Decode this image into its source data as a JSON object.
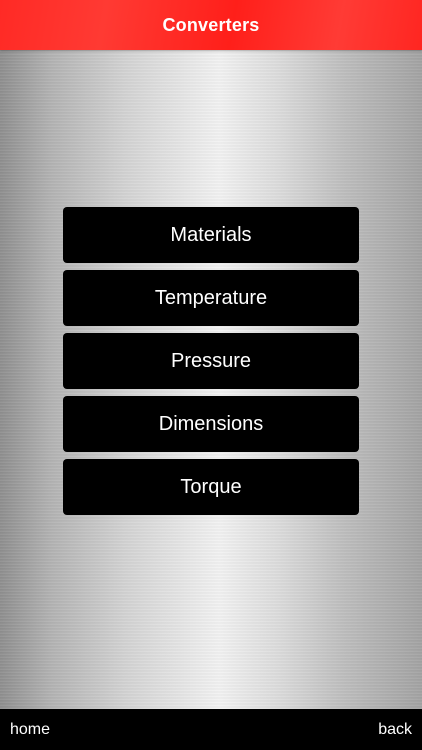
{
  "header": {
    "title": "Converters",
    "background_color": "#ff2a25"
  },
  "menu": {
    "items": [
      {
        "label": "Materials"
      },
      {
        "label": "Temperature"
      },
      {
        "label": "Pressure"
      },
      {
        "label": "Dimensions"
      },
      {
        "label": "Torque"
      }
    ]
  },
  "bottom_bar": {
    "home_label": "home",
    "back_label": "back"
  }
}
